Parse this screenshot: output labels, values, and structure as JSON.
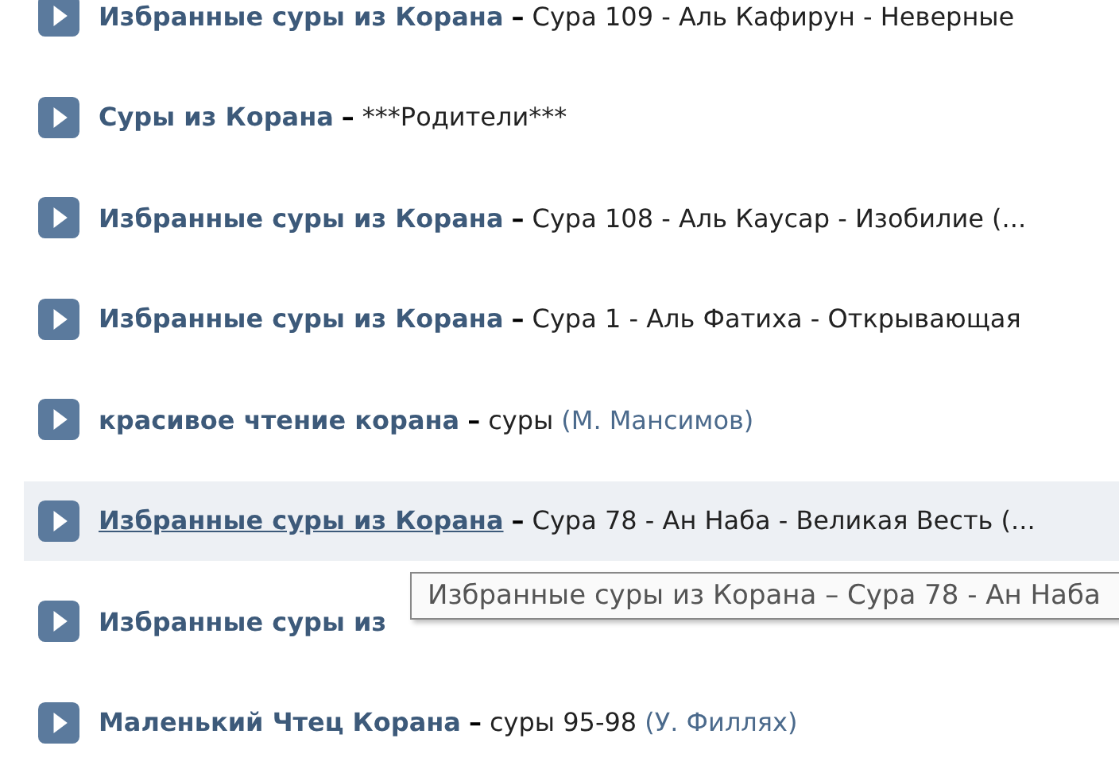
{
  "tracks": [
    {
      "artist": "Избранные суры из Корана",
      "title": "Сура 109 - Аль Кафирун - Неверные",
      "hovered": false
    },
    {
      "artist": "Суры из Корана",
      "title": "***Родители***",
      "hovered": false
    },
    {
      "artist": "Избранные суры из Корана",
      "title": "Сура 108 - Аль Каусар - Изобилие (...",
      "hovered": false
    },
    {
      "artist": "Избранные суры из Корана",
      "title": "Сура 1 - Аль Фатиха - Открывающая",
      "hovered": false
    },
    {
      "artist": "красивое чтение корана",
      "title": "суры",
      "note": "(М. Мансимов)",
      "hovered": false
    },
    {
      "artist": "Избранные суры из Корана",
      "title": "Сура 78 - Ан Наба - Великая Весть (...",
      "hovered": true
    },
    {
      "artist": "Избранные суры из",
      "hovered": false
    },
    {
      "artist": "Маленький Чтец Корана",
      "title": "суры 95-98",
      "note": "(У. Филлях)",
      "hovered": false
    }
  ],
  "separator": "–",
  "tooltip": {
    "text": "Избранные суры из Корана – Сура 78 - Ан Наба"
  }
}
